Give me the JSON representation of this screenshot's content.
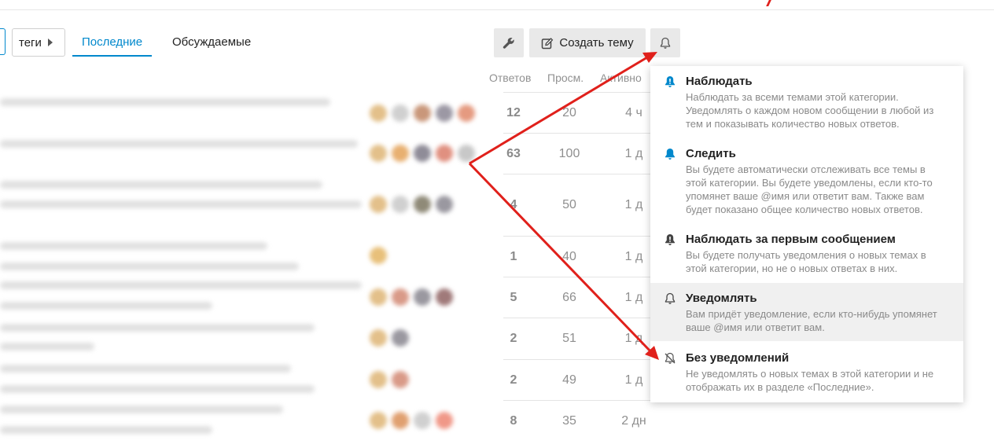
{
  "nav": {
    "tags_label": "теги",
    "latest_label": "Последние",
    "top_label": "Обсуждаемые"
  },
  "actions": {
    "create_topic_label": "Создать тему"
  },
  "table": {
    "headers": {
      "replies": "Ответов",
      "views": "Просм.",
      "activity": "Активно"
    },
    "rows": [
      {
        "replies": "12",
        "views": "20",
        "activity": "4 ч"
      },
      {
        "replies": "63",
        "views": "100",
        "activity": "1 д"
      },
      {
        "replies": "4",
        "views": "50",
        "activity": "1 д"
      },
      {
        "replies": "1",
        "views": "40",
        "activity": "1 д"
      },
      {
        "replies": "5",
        "views": "66",
        "activity": "1 д"
      },
      {
        "replies": "2",
        "views": "51",
        "activity": "1 д"
      },
      {
        "replies": "2",
        "views": "49",
        "activity": "1 д"
      },
      {
        "replies": "8",
        "views": "35",
        "activity": "2 дн"
      }
    ]
  },
  "notifications": {
    "options": [
      {
        "title": "Наблюдать",
        "desc": "Наблюдать за всеми темами этой категории. Уведомлять о каждом новом сообщении в любой из тем и показывать количество новых ответов.",
        "icon": "bell-exclamation-icon"
      },
      {
        "title": "Следить",
        "desc": "Вы будете автоматически отслеживать все темы в этой категории. Вы будете уведомлены, если кто-то упомянет ваше @имя или ответит вам. Также вам будет показано общее количество новых ответов.",
        "icon": "bell-filled-icon"
      },
      {
        "title": "Наблюдать за первым сообщением",
        "desc": "Вы будете получать уведомления о новых темах в этой категории, но не о новых ответах в них.",
        "icon": "bell-exclamation-dark-icon"
      },
      {
        "title": "Уведомлять",
        "desc": "Вам придёт уведомление, если кто-нибудь упомянет ваше @имя или ответит вам.",
        "icon": "bell-outline-icon"
      },
      {
        "title": "Без уведомлений",
        "desc": "Не уведомлять о новых темах в этой категории и не отображать их в разделе «Последние».",
        "icon": "bell-slash-icon"
      }
    ],
    "selected_index": 3
  },
  "colors": {
    "accent": "#0088cc",
    "annotation": "#e0201b",
    "highlight": "#f0f0f0"
  }
}
